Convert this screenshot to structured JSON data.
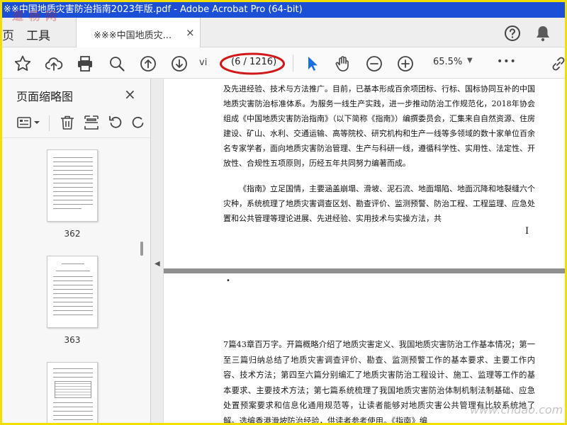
{
  "window": {
    "title": "※※中国地质灾害防治指南2023年版.pdf - Adobe Acrobat Pro (64-bit)"
  },
  "menu": {
    "home_fragment": "页",
    "tools": "工具",
    "tab_label": "※※※中国地质灾...",
    "tab_close": "×"
  },
  "toolbar": {
    "page_label": "vi",
    "page_count": "(6 / 1216)",
    "zoom": "65.5%",
    "more": "•••"
  },
  "panel": {
    "title": "页面缩略图",
    "close": "×",
    "thumbnails": [
      {
        "label": "362"
      },
      {
        "label": "363"
      },
      {
        "label": ""
      }
    ]
  },
  "document": {
    "para1": "及先进经验、技术与方法推广。目前，已基本形成百余项团标、行标、国标协同互补的中国地质灾害防治标准体系。为服务一线生产实践，进一步推动防治工作规范化，2018年协会组成《中国地质灾害防治指南》（以下简称《指南》）编撰委员会，汇集来自自然资源、住房建设、矿山、水利、交通运输、高等院校、研究机构和生产一线等多领域的数十家单位百余名专家学者，面向地质灾害防治管理、生产与科研一线，遵循科学性、实用性、法定性、开放性、合规性五项原则，历经五年共同努力编著而成。",
    "para2": "《指南》立足国情，主要涵盖崩塌、滑坡、泥石流、地面塌陷、地面沉降和地裂缝六个灾种，系统梳理了地质灾害调查区划、勘查评价、监测预警、防治工程、工程监理、应急处置和公共管理等理论进展、先进经验、实用技术与实操方法，共",
    "page_roman": "I",
    "page_dot": "•",
    "para3": "7篇43章百万字。开篇概略介绍了地质灾害定义、我国地质灾害防治工作基本情况；第一至三篇归纳总结了地质灾害调查评价、勘查、监测预警工作的基本要求、主要工作内容、技术方法；第四至六篇分别编汇了地质灾害防治工程设计、施工、监理等工作的基本要求、主要技术方法；第七篇系统梳理了我国地质灾害防治体制机制法制基础、应急处置预案要求和信息化通用规范等，让读者能够对地质灾害公共管理有比较系统地了解。选编香港滑坡防治经验，供读者参考使用。《指南》编"
  },
  "watermarks": {
    "top_left": "道 杨 网",
    "bottom_right": "www.cndao.com"
  },
  "colors": {
    "titlebar": "#1a4fd6",
    "frame": "#f2df00",
    "annotation_ellipse": "#d01818",
    "select_arrow": "#1a6fe0"
  }
}
